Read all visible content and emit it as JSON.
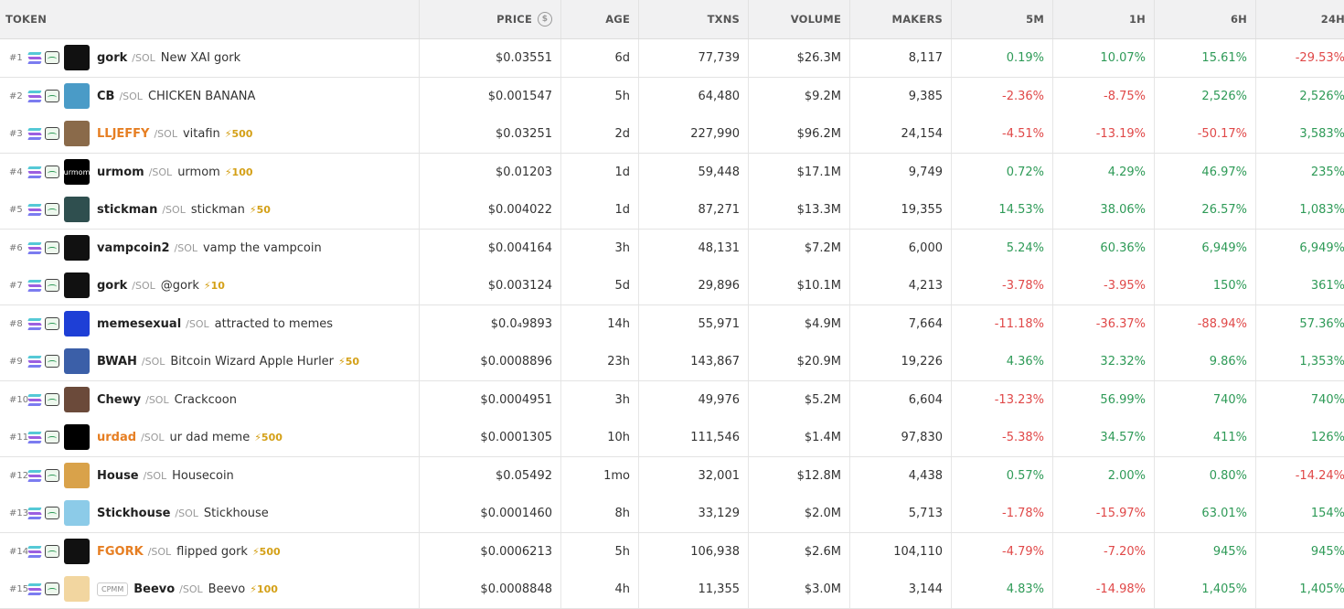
{
  "header": {
    "token": "TOKEN",
    "price": "PRICE",
    "age": "AGE",
    "txns": "TXNS",
    "volume": "VOLUME",
    "makers": "MAKERS",
    "m5": "5M",
    "h1": "1H",
    "h6": "6H",
    "h24": "24H"
  },
  "colors": {
    "positive": "#2e9a57",
    "negative": "#e04848",
    "boosted_symbol": "#e67e22",
    "boost_badge": "#d4a017"
  },
  "rows": [
    {
      "rank": "#1",
      "symbol": "gork",
      "quote": "/SOL",
      "name": "New XAI gork",
      "boost": "",
      "boosted": false,
      "cpmm": "",
      "avatar_color": "#111111",
      "avatar_text": "",
      "price": "$0.03551",
      "age": "6d",
      "txns": "77,739",
      "volume": "$26.3M",
      "makers": "8,117",
      "m5": "0.19%",
      "h1": "10.07%",
      "h6": "15.61%",
      "h24": "-29.53%"
    },
    {
      "rank": "#2",
      "symbol": "CB",
      "quote": "/SOL",
      "name": "CHICKEN BANANA",
      "boost": "",
      "boosted": false,
      "cpmm": "",
      "avatar_color": "#4a9bc7",
      "avatar_text": "",
      "price": "$0.001547",
      "age": "5h",
      "txns": "64,480",
      "volume": "$9.2M",
      "makers": "9,385",
      "m5": "-2.36%",
      "h1": "-8.75%",
      "h6": "2,526%",
      "h24": "2,526%"
    },
    {
      "rank": "#3",
      "symbol": "LLJEFFY",
      "quote": "/SOL",
      "name": "vitafin",
      "boost": "⚡500",
      "boosted": true,
      "cpmm": "",
      "avatar_color": "#8a6a4a",
      "avatar_text": "",
      "price": "$0.03251",
      "age": "2d",
      "txns": "227,990",
      "volume": "$96.2M",
      "makers": "24,154",
      "m5": "-4.51%",
      "h1": "-13.19%",
      "h6": "-50.17%",
      "h24": "3,583%"
    },
    {
      "rank": "#4",
      "symbol": "urmom",
      "quote": "/SOL",
      "name": "urmom",
      "boost": "⚡100",
      "boosted": false,
      "cpmm": "",
      "avatar_color": "#000000",
      "avatar_text": "urmom",
      "price": "$0.01203",
      "age": "1d",
      "txns": "59,448",
      "volume": "$17.1M",
      "makers": "9,749",
      "m5": "0.72%",
      "h1": "4.29%",
      "h6": "46.97%",
      "h24": "235%"
    },
    {
      "rank": "#5",
      "symbol": "stickman",
      "quote": "/SOL",
      "name": "stickman",
      "boost": "⚡50",
      "boosted": false,
      "cpmm": "",
      "avatar_color": "#2f4f4f",
      "avatar_text": "",
      "price": "$0.004022",
      "age": "1d",
      "txns": "87,271",
      "volume": "$13.3M",
      "makers": "19,355",
      "m5": "14.53%",
      "h1": "38.06%",
      "h6": "26.57%",
      "h24": "1,083%"
    },
    {
      "rank": "#6",
      "symbol": "vampcoin2",
      "quote": "/SOL",
      "name": "vamp the vampcoin",
      "boost": "",
      "boosted": false,
      "cpmm": "",
      "avatar_color": "#111111",
      "avatar_text": "",
      "price": "$0.004164",
      "age": "3h",
      "txns": "48,131",
      "volume": "$7.2M",
      "makers": "6,000",
      "m5": "5.24%",
      "h1": "60.36%",
      "h6": "6,949%",
      "h24": "6,949%"
    },
    {
      "rank": "#7",
      "symbol": "gork",
      "quote": "/SOL",
      "name": "@gork",
      "boost": "⚡10",
      "boosted": false,
      "cpmm": "",
      "avatar_color": "#111111",
      "avatar_text": "",
      "price": "$0.003124",
      "age": "5d",
      "txns": "29,896",
      "volume": "$10.1M",
      "makers": "4,213",
      "m5": "-3.78%",
      "h1": "-3.95%",
      "h6": "150%",
      "h24": "361%"
    },
    {
      "rank": "#8",
      "symbol": "memesexual",
      "quote": "/SOL",
      "name": "attracted to memes",
      "boost": "",
      "boosted": false,
      "cpmm": "",
      "avatar_color": "#1e3fd6",
      "avatar_text": "",
      "price": "$0.0₄9893",
      "age": "14h",
      "txns": "55,971",
      "volume": "$4.9M",
      "makers": "7,664",
      "m5": "-11.18%",
      "h1": "-36.37%",
      "h6": "-88.94%",
      "h24": "57.36%"
    },
    {
      "rank": "#9",
      "symbol": "BWAH",
      "quote": "/SOL",
      "name": "Bitcoin Wizard Apple Hurler",
      "boost": "⚡50",
      "boosted": false,
      "cpmm": "",
      "avatar_color": "#3b5fa8",
      "avatar_text": "",
      "price": "$0.0008896",
      "age": "23h",
      "txns": "143,867",
      "volume": "$20.9M",
      "makers": "19,226",
      "m5": "4.36%",
      "h1": "32.32%",
      "h6": "9.86%",
      "h24": "1,353%"
    },
    {
      "rank": "#10",
      "symbol": "Chewy",
      "quote": "/SOL",
      "name": "Crackcoon",
      "boost": "",
      "boosted": false,
      "cpmm": "",
      "avatar_color": "#6b4a3a",
      "avatar_text": "",
      "price": "$0.0004951",
      "age": "3h",
      "txns": "49,976",
      "volume": "$5.2M",
      "makers": "6,604",
      "m5": "-13.23%",
      "h1": "56.99%",
      "h6": "740%",
      "h24": "740%"
    },
    {
      "rank": "#11",
      "symbol": "urdad",
      "quote": "/SOL",
      "name": "ur dad meme",
      "boost": "⚡500",
      "boosted": true,
      "cpmm": "",
      "avatar_color": "#000000",
      "avatar_text": "",
      "price": "$0.0001305",
      "age": "10h",
      "txns": "111,546",
      "volume": "$1.4M",
      "makers": "97,830",
      "m5": "-5.38%",
      "h1": "34.57%",
      "h6": "411%",
      "h24": "126%"
    },
    {
      "rank": "#12",
      "symbol": "House",
      "quote": "/SOL",
      "name": "Housecoin",
      "boost": "",
      "boosted": false,
      "cpmm": "",
      "avatar_color": "#d9a24a",
      "avatar_text": "",
      "price": "$0.05492",
      "age": "1mo",
      "txns": "32,001",
      "volume": "$12.8M",
      "makers": "4,438",
      "m5": "0.57%",
      "h1": "2.00%",
      "h6": "0.80%",
      "h24": "-14.24%"
    },
    {
      "rank": "#13",
      "symbol": "Stickhouse",
      "quote": "/SOL",
      "name": "Stickhouse",
      "boost": "",
      "boosted": false,
      "cpmm": "",
      "avatar_color": "#8ccbe8",
      "avatar_text": "",
      "price": "$0.0001460",
      "age": "8h",
      "txns": "33,129",
      "volume": "$2.0M",
      "makers": "5,713",
      "m5": "-1.78%",
      "h1": "-15.97%",
      "h6": "63.01%",
      "h24": "154%"
    },
    {
      "rank": "#14",
      "symbol": "FGORK",
      "quote": "/SOL",
      "name": "flipped gork",
      "boost": "⚡500",
      "boosted": true,
      "cpmm": "",
      "avatar_color": "#111111",
      "avatar_text": "",
      "price": "$0.0006213",
      "age": "5h",
      "txns": "106,938",
      "volume": "$2.6M",
      "makers": "104,110",
      "m5": "-4.79%",
      "h1": "-7.20%",
      "h6": "945%",
      "h24": "945%"
    },
    {
      "rank": "#15",
      "symbol": "Beevo",
      "quote": "/SOL",
      "name": "Beevo",
      "boost": "⚡100",
      "boosted": false,
      "cpmm": "CPMM",
      "avatar_color": "#f2d6a0",
      "avatar_text": "",
      "price": "$0.0008848",
      "age": "4h",
      "txns": "11,355",
      "volume": "$3.0M",
      "makers": "3,144",
      "m5": "4.83%",
      "h1": "-14.98%",
      "h6": "1,405%",
      "h24": "1,405%"
    }
  ]
}
